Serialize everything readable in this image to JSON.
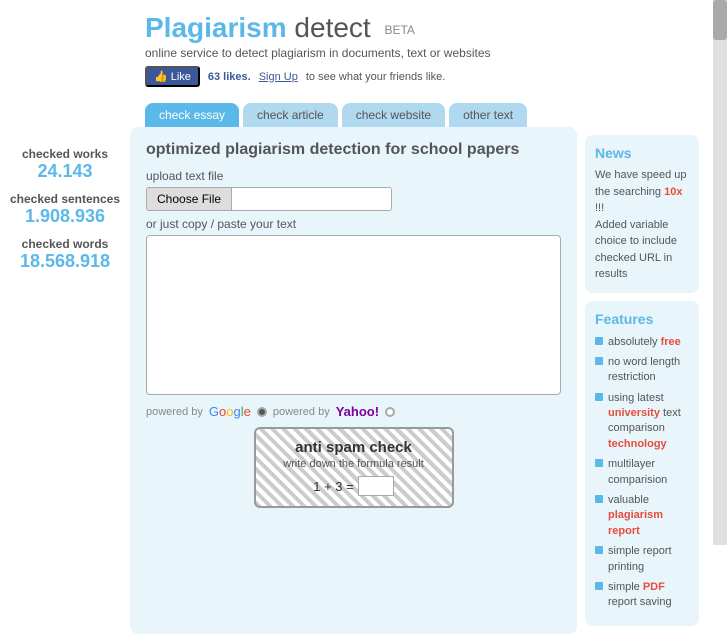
{
  "header": {
    "title_blue": "Plagiarism",
    "title_rest": " detect",
    "beta": "BETA",
    "tagline": "online service to detect plagiarism in documents, text or websites",
    "fb_likes": "63 likes.",
    "fb_signup": "Sign Up",
    "fb_signup_suffix": " to see what your friends like."
  },
  "tabs": [
    {
      "label": "check essay",
      "active": true
    },
    {
      "label": "check article",
      "active": false
    },
    {
      "label": "check website",
      "active": false
    },
    {
      "label": "other text",
      "active": false
    }
  ],
  "left_sidebar": {
    "stat1_label": "checked works",
    "stat1_value": "24.143",
    "stat2_label": "checked sentences",
    "stat2_value": "1.908.936",
    "stat3_label": "checked words",
    "stat3_value": "18.568.918"
  },
  "center": {
    "heading": "optimized plagiarism detection for school papers",
    "upload_label": "upload text file",
    "choose_file_btn": "Choose File",
    "file_placeholder": "",
    "paste_label": "or just copy / paste your text",
    "textarea_placeholder": "",
    "powered_by1": "powered by",
    "powered_by2": "powered by"
  },
  "antispam": {
    "title": "anti spam check",
    "subtitle": "write down the formula result",
    "formula": "1 + 3 ="
  },
  "right_sidebar": {
    "news_title": "News",
    "news_text1": "We have speed up the searching ",
    "news_highlight": "10x",
    "news_text2": " !!!",
    "news_text3": "Added variable choice to include checked URL in results",
    "features_title": "Features",
    "features": [
      {
        "text": "absolutely ",
        "highlight": "free",
        "highlight_class": "red",
        "rest": ""
      },
      {
        "text": "no word length restriction",
        "highlight": "",
        "highlight_class": "",
        "rest": ""
      },
      {
        "text": "using latest ",
        "highlight": "university",
        "highlight_class": "red",
        "rest": " text comparison "
      },
      {
        "text2": "technology",
        "highlight_class": "red"
      },
      {
        "text": "multilayer comparision",
        "highlight": "",
        "highlight_class": "",
        "rest": ""
      },
      {
        "text": "valuable ",
        "highlight": "plagiarism report",
        "highlight_class": "red",
        "rest": ""
      },
      {
        "text": "simple report printing",
        "highlight": "",
        "highlight_class": "",
        "rest": ""
      },
      {
        "text": "simple ",
        "highlight": "PDF",
        "highlight_class": "red",
        "rest": " report saving"
      }
    ]
  },
  "icons": {
    "fb_thumb": "👍",
    "radio": "●"
  }
}
